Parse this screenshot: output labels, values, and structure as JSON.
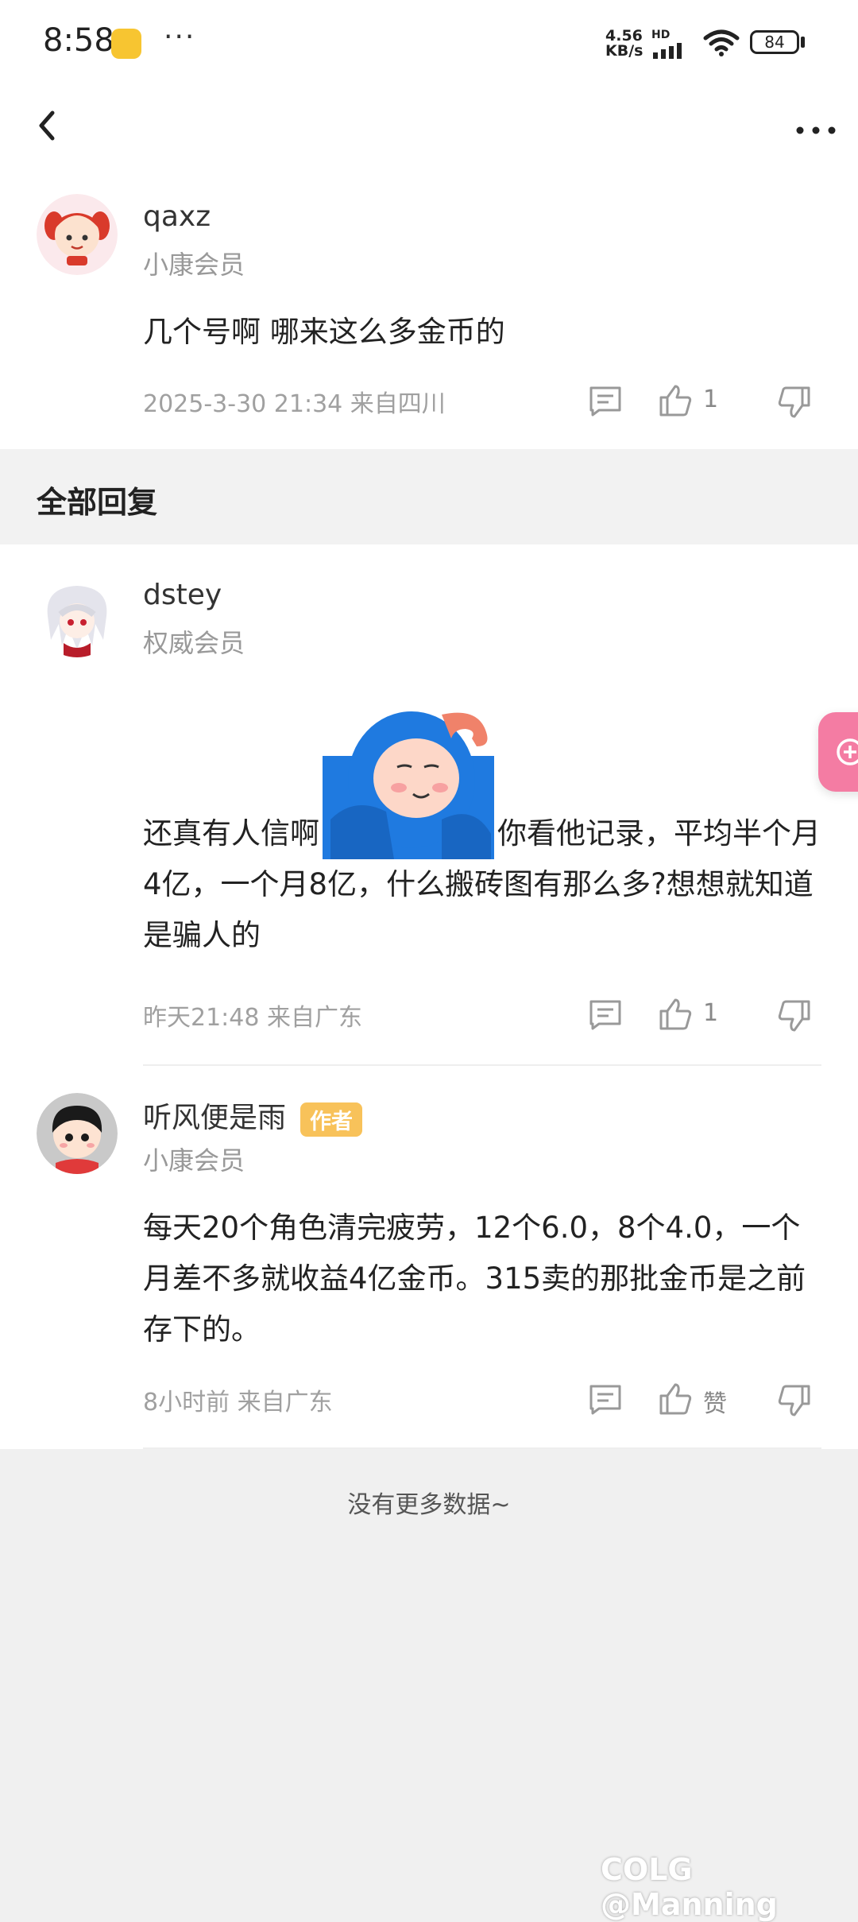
{
  "status": {
    "time": "8:58",
    "speed_value": "4.56",
    "speed_unit": "KB/s",
    "hd": "HD",
    "battery": "84"
  },
  "nav": {
    "back_icon": "chevron-left-icon",
    "more_icon": "more-dots-icon"
  },
  "top_comment": {
    "username": "qaxz",
    "member": "小康会员",
    "content": "几个号啊 哪来这么多金币的",
    "meta": "2025-3-30 21:34  来自四川",
    "likes": "1"
  },
  "replies_header": "全部回复",
  "replies": [
    {
      "username": "dstey",
      "member": "权威会员",
      "content_before": "还真有人信啊",
      "content_after": "你看他记录，平均半个月4亿，一个月8亿，什么搬砖图有那么多?想想就知道是骗人的",
      "meta": "昨天21:48 来自广东",
      "likes": "1"
    },
    {
      "username": "听风便是雨",
      "badge": "作者",
      "member": "小康会员",
      "content": "每天20个角色清完疲劳，12个6.0，8个4.0，一个月差不多就收益4亿金币。315卖的那批金币是之前存下的。",
      "meta": "8小时前 来自广东",
      "likes": "赞"
    }
  ],
  "footer": "没有更多数据~",
  "watermark": "@Manning"
}
